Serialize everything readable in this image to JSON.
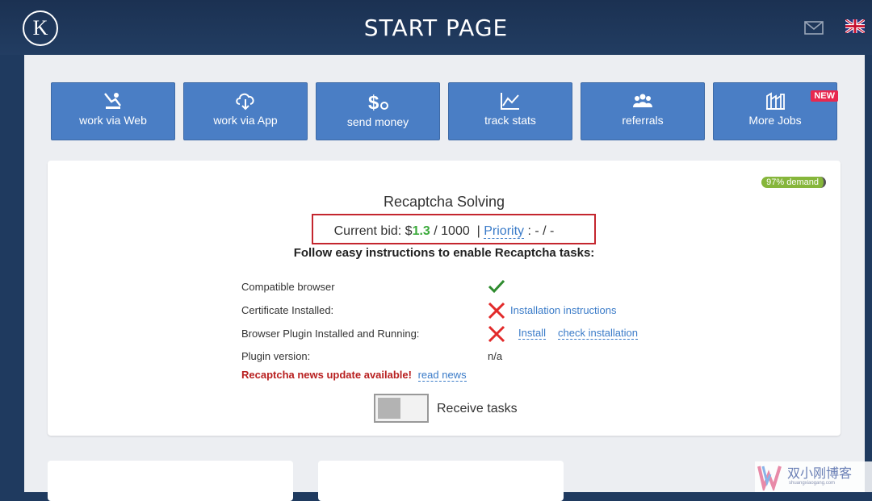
{
  "header": {
    "logo_letter": "K",
    "title": "START PAGE",
    "icons": [
      "mail-icon",
      "uk-flag-icon"
    ]
  },
  "tiles": [
    {
      "label": "work via Web",
      "icon": "web-worker-icon"
    },
    {
      "label": "work via App",
      "icon": "cloud-download-icon"
    },
    {
      "label": "send money",
      "icon": "dollar-icon"
    },
    {
      "label": "track stats",
      "icon": "stats-chart-icon"
    },
    {
      "label": "referrals",
      "icon": "people-icon"
    },
    {
      "label": "More Jobs",
      "icon": "factory-icon",
      "badge": "NEW"
    }
  ],
  "job": {
    "demand": "97% demand",
    "title": "Recaptcha Solving",
    "bid_prefix": "Current bid: $",
    "bid_amount": "1.3",
    "bid_suffix": " / 1000  |",
    "priority_link": "Priority",
    "priority_value": " : - / -",
    "instructions": "Follow easy instructions to enable Recaptcha tasks:",
    "checks": [
      {
        "label": "Compatible browser",
        "status": "ok"
      },
      {
        "label": "Certificate Installed:",
        "status": "fail",
        "link": "Installation instructions"
      },
      {
        "label": "Browser Plugin Installed and Running:",
        "status": "fail",
        "links": [
          "Install",
          "check installation"
        ]
      },
      {
        "label": "Plugin version:",
        "value": "n/a"
      }
    ],
    "news_text": "Recaptcha news update available!",
    "news_link": "read news",
    "toggle_label": "Receive tasks",
    "toggle_on": false
  },
  "watermark": {
    "text": "双小刚博客",
    "sub": "shuangxiaogang.com"
  },
  "colors": {
    "tile": "#4a7ec5",
    "header": "#1f3a5f",
    "accent_green": "#3caa3c",
    "highlight_box": "#c4262e",
    "badge": "#e8284f"
  }
}
